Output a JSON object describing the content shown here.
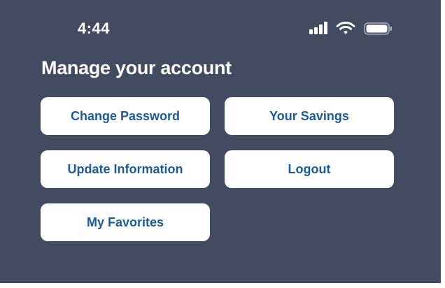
{
  "status_bar": {
    "time": "4:44",
    "icons": [
      "signal-icon",
      "wifi-icon",
      "battery-icon"
    ]
  },
  "page": {
    "title": "Manage your account"
  },
  "buttons": {
    "change_password": "Change Password",
    "your_savings": "Your Savings",
    "update_information": "Update Information",
    "logout": "Logout",
    "my_favorites": "My Favorites"
  },
  "colors": {
    "background": "#424b5f",
    "button_background": "#ffffff",
    "button_text": "#1c5b99",
    "title_text": "#ffffff"
  }
}
